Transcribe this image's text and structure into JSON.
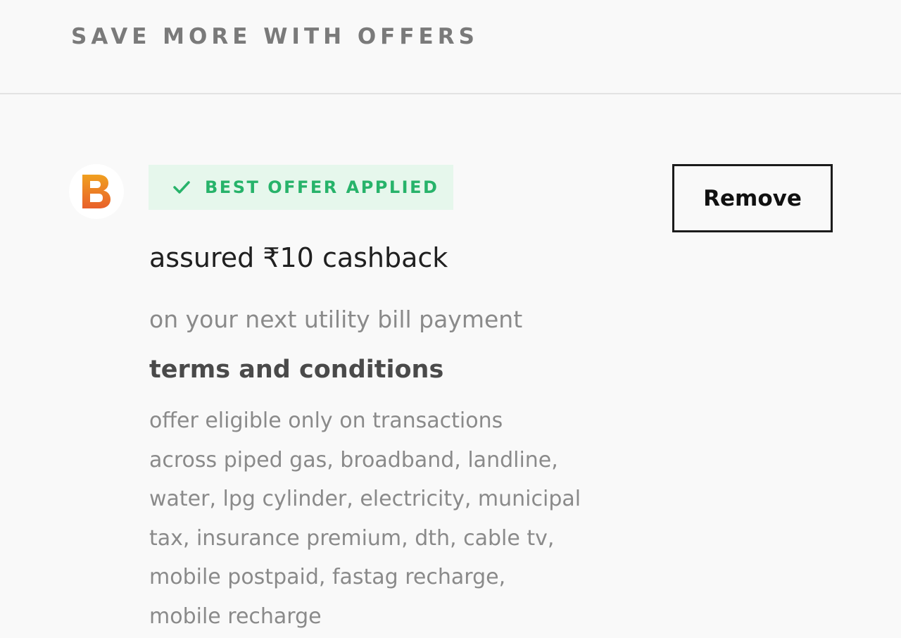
{
  "section": {
    "title": "SAVE MORE WITH OFFERS"
  },
  "offer": {
    "logo_icon": "bill-payment-logo-icon",
    "badge": {
      "icon": "check-icon",
      "label": "BEST OFFER APPLIED",
      "color": "#27b36a",
      "background": "#e6f7ec"
    },
    "remove_label": "Remove",
    "title": "assured ₹10 cashback",
    "subtitle": "on your next utility bill payment",
    "terms_heading": "terms and conditions",
    "terms_lines": [
      "offer eligible only on transactions",
      "across piped gas, broadband, landline,",
      "water, lpg cylinder, electricity, municipal",
      "tax, insurance premium, dth, cable tv,",
      "mobile postpaid, fastag recharge,",
      "mobile recharge"
    ]
  }
}
